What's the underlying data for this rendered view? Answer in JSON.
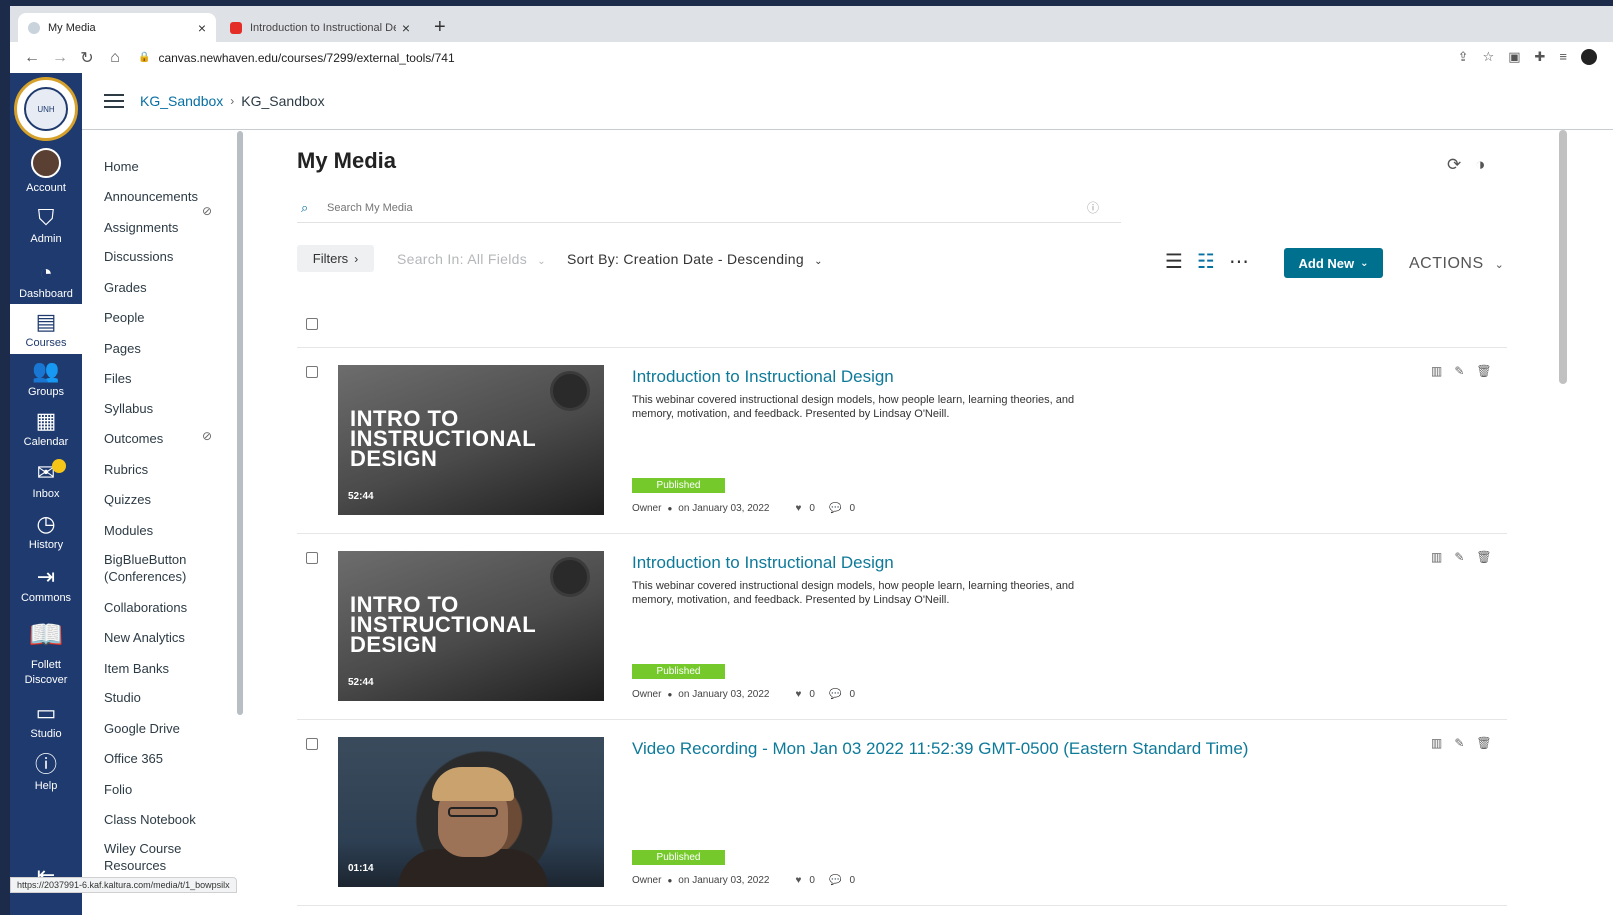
{
  "browser": {
    "tabs": [
      {
        "title": "My Media",
        "active": true
      },
      {
        "title": "Introduction to Instructional De",
        "active": false
      }
    ],
    "url": "canvas.newhaven.edu/courses/7299/external_tools/741",
    "status_url": "https://2037991-6.kaf.kaltura.com/media/t/1_bowpsilx"
  },
  "global_nav": {
    "logo_alt": "UNIVERSITY OF NEW HAVEN",
    "items": [
      {
        "label": "Account",
        "icon": "avatar-icon"
      },
      {
        "label": "Admin",
        "icon": "shield-icon"
      },
      {
        "label": "Dashboard",
        "icon": "dashboard-icon"
      },
      {
        "label": "Courses",
        "icon": "courses-icon",
        "active": true
      },
      {
        "label": "Groups",
        "icon": "groups-icon"
      },
      {
        "label": "Calendar",
        "icon": "calendar-icon"
      },
      {
        "label": "Inbox",
        "icon": "inbox-icon"
      },
      {
        "label": "History",
        "icon": "clock-icon"
      },
      {
        "label": "Commons",
        "icon": "commons-icon"
      },
      {
        "label": "Follett Discover",
        "icon": "book-icon"
      },
      {
        "label": "Studio",
        "icon": "studio-icon"
      },
      {
        "label": "Help",
        "icon": "help-icon"
      }
    ]
  },
  "breadcrumb": {
    "course": "KG_Sandbox",
    "current": "KG_Sandbox"
  },
  "course_nav": [
    "Home",
    "Announcements",
    "Assignments",
    "Discussions",
    "Grades",
    "People",
    "Pages",
    "Files",
    "Syllabus",
    "Outcomes",
    "Rubrics",
    "Quizzes",
    "Modules",
    "BigBlueButton (Conferences)",
    "Collaborations",
    "New Analytics",
    "Item Banks",
    "Studio",
    "Google Drive",
    "Office 365",
    "Folio",
    "Class Notebook",
    "Wiley Course Resources"
  ],
  "media": {
    "title": "My Media",
    "search_placeholder": "Search My Media",
    "filters_label": "Filters",
    "search_in_label": "Search In: All Fields",
    "sort_label": "Sort By: Creation Date - Descending",
    "add_new_label": "Add New",
    "actions_label": "ACTIONS",
    "entries": [
      {
        "title": "Introduction to Instructional Design",
        "description": "This webinar covered instructional design models, how people learn, learning theories, and memory, motivation, and feedback. Presented by Lindsay O'Neill.",
        "thumb_text": "INTRO TO INSTRUCTIONAL DESIGN",
        "duration": "52:44",
        "status": "Published",
        "owner": "Owner",
        "date": "on January 03, 2022",
        "likes": "0",
        "comments": "0"
      },
      {
        "title": "Introduction to Instructional Design",
        "description": "This webinar covered instructional design models, how people learn, learning theories, and memory, motivation, and feedback. Presented by Lindsay O'Neill.",
        "thumb_text": "INTRO TO INSTRUCTIONAL DESIGN",
        "duration": "52:44",
        "status": "Published",
        "owner": "Owner",
        "date": "on January 03, 2022",
        "likes": "0",
        "comments": "0"
      },
      {
        "title": "Video Recording - Mon Jan 03 2022 11:52:39 GMT-0500 (Eastern Standard Time)",
        "description": "",
        "thumb_text": "",
        "duration": "01:14",
        "status": "Published",
        "owner": "Owner",
        "date": "on January 03, 2022",
        "likes": "0",
        "comments": "0"
      }
    ]
  },
  "colors": {
    "canvas_nav": "#1e3a6e",
    "link": "#0770a3",
    "add_new": "#00708f",
    "published": "#75c92b"
  }
}
